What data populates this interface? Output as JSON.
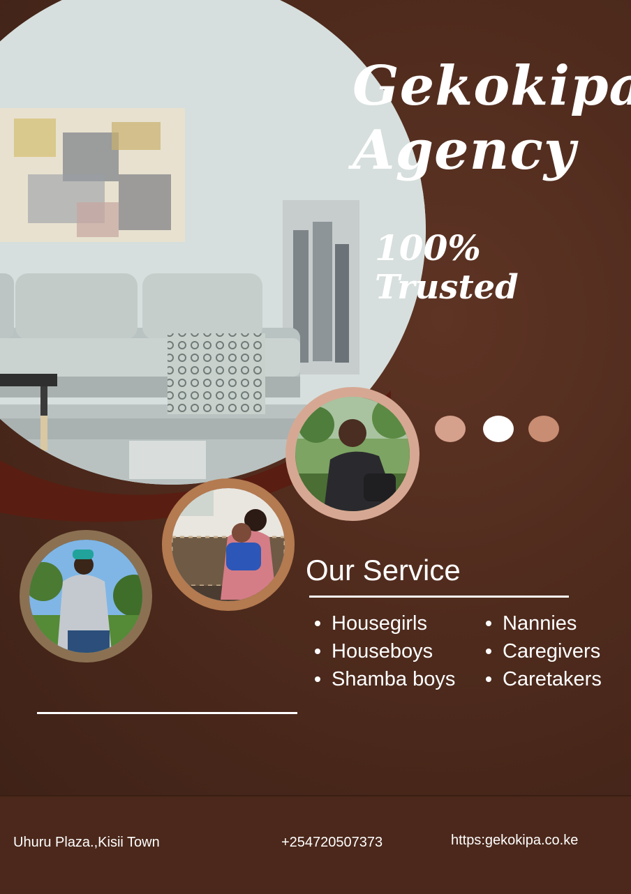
{
  "brand": {
    "line1": "Gekokipa",
    "line2": "Agency"
  },
  "tagline": {
    "line1": "100%",
    "line2": "Trusted"
  },
  "services": {
    "heading": "Our Service",
    "left": [
      "Housegirls",
      "Houseboys",
      "Shamba boys"
    ],
    "right": [
      "Nannies",
      "Caregivers",
      "Caretakers"
    ]
  },
  "footer": {
    "address": "Uhuru Plaza.,Kisii Town",
    "phone": "+254720507373",
    "website": "https:gekokipa.co.ke"
  },
  "colors": {
    "background": "#4f2b1d",
    "footer": "#4b281b",
    "dot_1": "#d5a18d",
    "dot_2": "#ffffff",
    "dot_3": "#c88d72",
    "ring_1": "#d6a893",
    "ring_2": "#b47a50",
    "ring_3": "#8b7152"
  }
}
